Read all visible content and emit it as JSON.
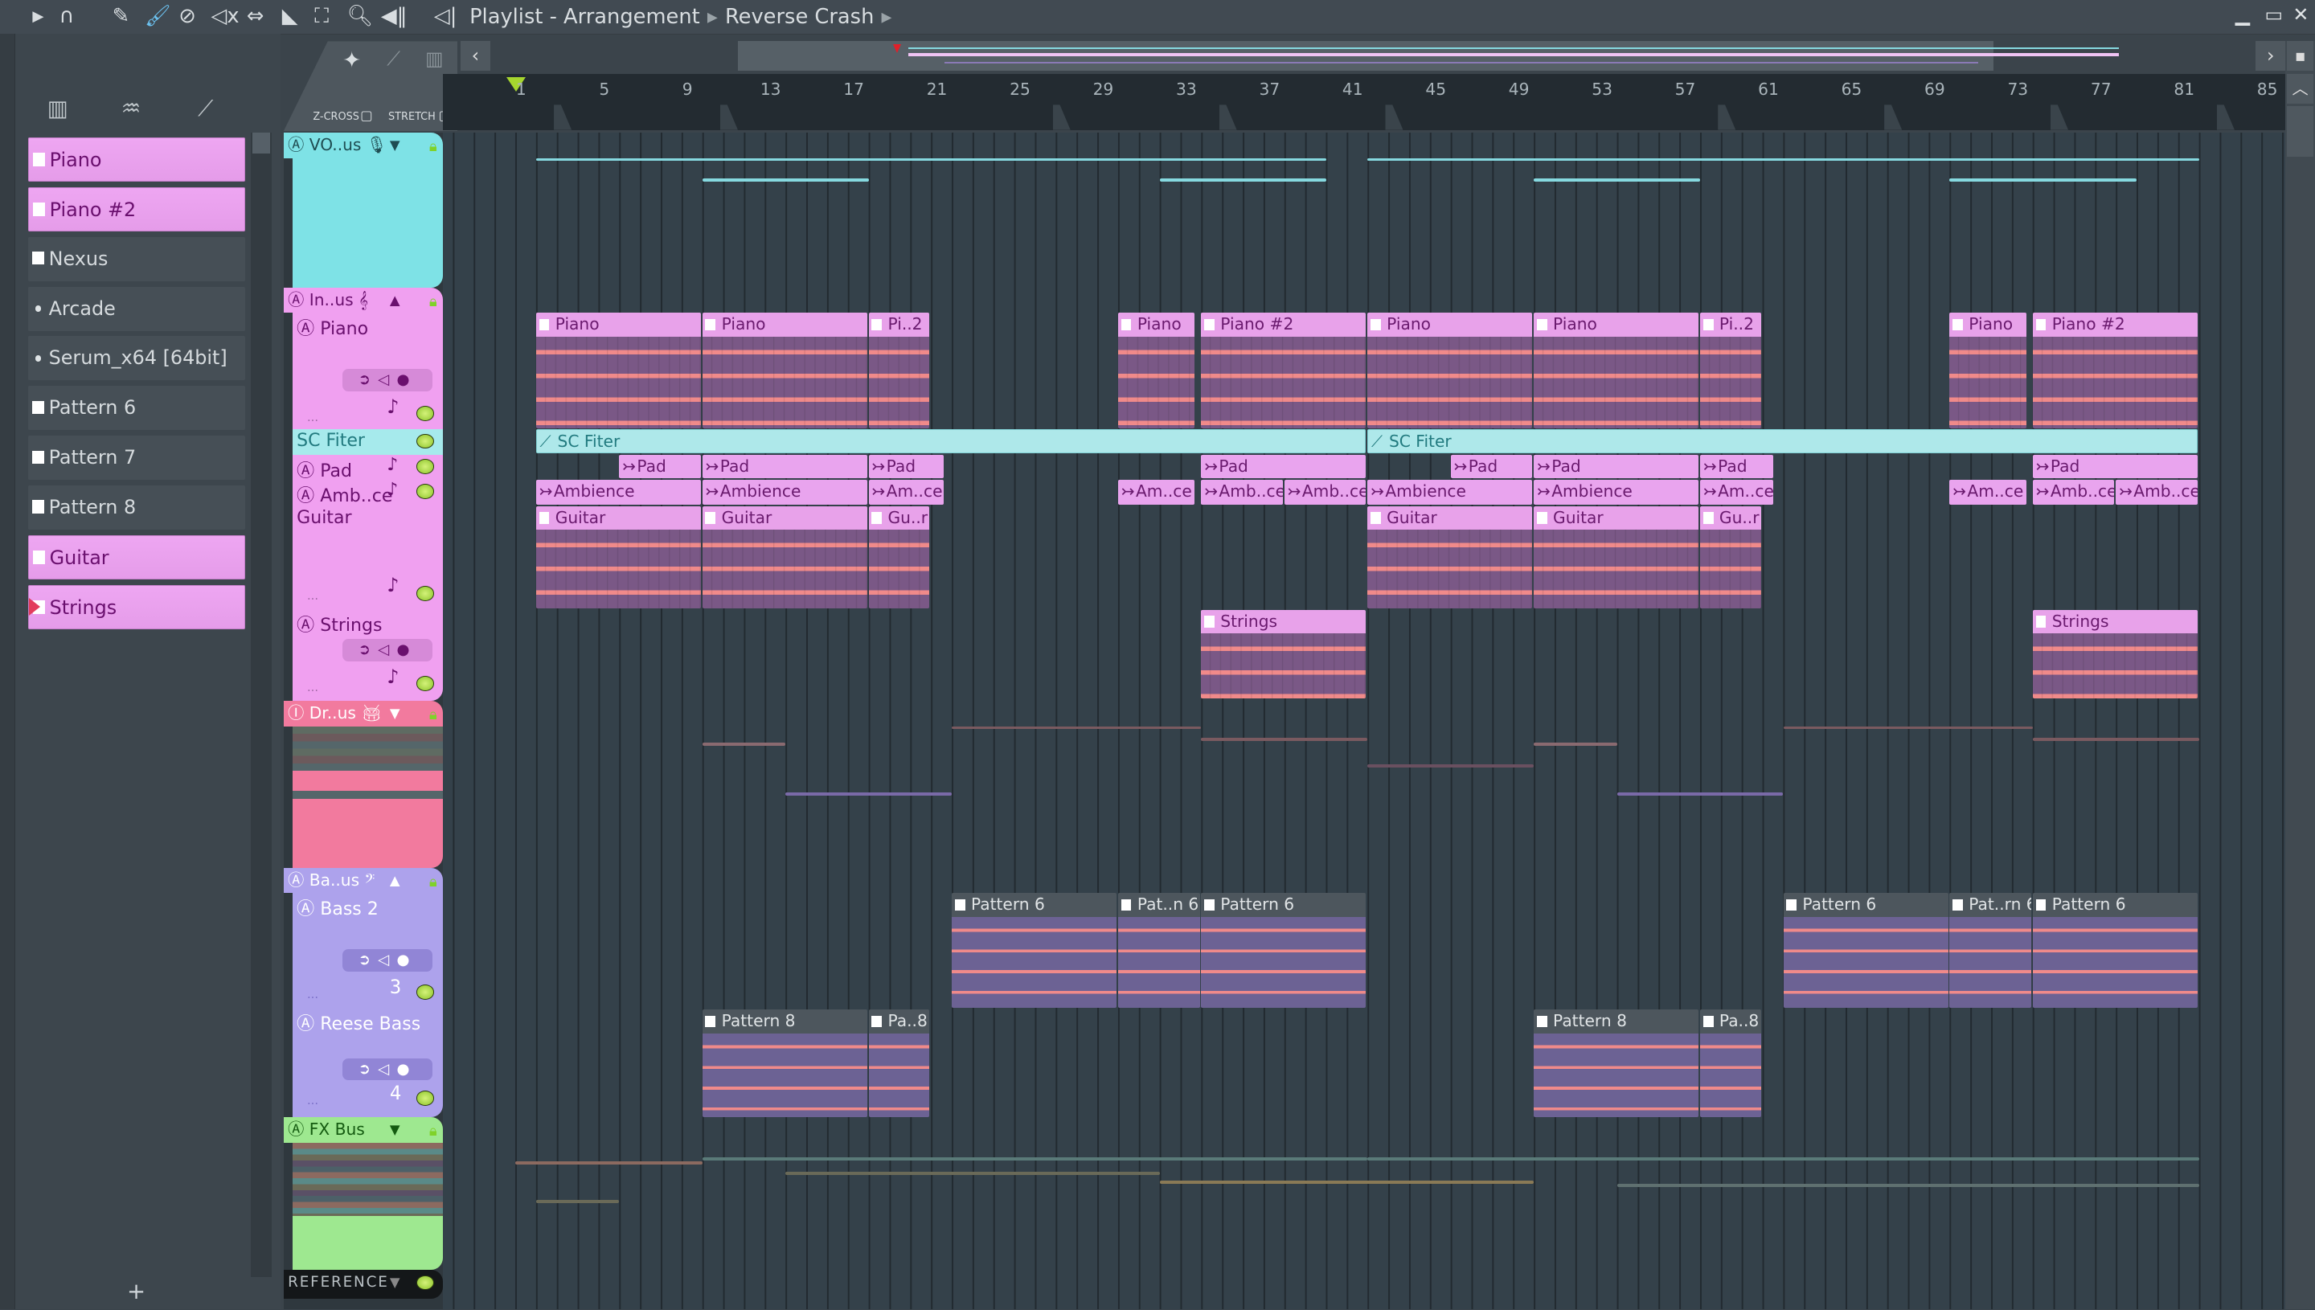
{
  "window": {
    "title": "Playlist - Arrangement",
    "pattern": "Reverse Crash",
    "min_icon": "minimize-icon",
    "max_icon": "maximize-icon",
    "close_icon": "close-icon"
  },
  "toolbar": {
    "icons": [
      "play-arrow-icon",
      "magnet-icon",
      "pencil-icon",
      "paint-brush-icon",
      "delete-icon",
      "mute-icon",
      "slip-icon",
      "slice-icon",
      "select-icon",
      "zoom-icon",
      "playback-icon",
      "speaker-icon"
    ]
  },
  "browser": {
    "items": [
      {
        "label": "Piano",
        "kind": "pattern",
        "style": "pink"
      },
      {
        "label": "Piano #2",
        "kind": "pattern",
        "style": "pink"
      },
      {
        "label": "Nexus",
        "kind": "pattern",
        "style": "gray"
      },
      {
        "label": "Arcade",
        "kind": "plugin",
        "style": "gray"
      },
      {
        "label": "Serum_x64 [64bit]",
        "kind": "plugin",
        "style": "gray"
      },
      {
        "label": "Pattern 6",
        "kind": "pattern",
        "style": "gray"
      },
      {
        "label": "Pattern 7",
        "kind": "pattern",
        "style": "gray"
      },
      {
        "label": "Pattern 8",
        "kind": "pattern",
        "style": "gray"
      },
      {
        "label": "Guitar",
        "kind": "pattern",
        "style": "pink"
      },
      {
        "label": "Strings",
        "kind": "pattern",
        "style": "pink",
        "selected": true
      }
    ],
    "add_label": "+"
  },
  "snap": {
    "zcross": "Z-CROSS",
    "stretch": "STRETCH"
  },
  "ruler": {
    "bars": [
      "1",
      "5",
      "9",
      "13",
      "17",
      "21",
      "25",
      "29",
      "33",
      "37",
      "41",
      "45",
      "49",
      "53",
      "57",
      "61",
      "65",
      "69",
      "73",
      "77",
      "81",
      "85"
    ],
    "playhead_bar": 1
  },
  "tracks": {
    "vo": {
      "label": "VO..us",
      "color": "#7ee2e6"
    },
    "inst": {
      "label": "In..us",
      "color": "#f0a0f0",
      "piano": "Piano",
      "sc": "SC Fiter",
      "pad": "Pad",
      "amb": "Amb..ce",
      "guitar": "Guitar",
      "strings": "Strings"
    },
    "drums": {
      "label": "Dr..us",
      "color": "#f27a9e"
    },
    "bass": {
      "label": "Ba..us",
      "color": "#ada2ec",
      "bass2": "Bass 2",
      "bass2_num": "3",
      "reese": "Reese Bass",
      "reese_num": "4"
    },
    "fx": {
      "label": "FX Bus",
      "color": "#9ee890"
    },
    "reference": {
      "label": "REFERENCE"
    }
  },
  "dots": "...",
  "clips": {
    "piano": [
      {
        "label": "Piano",
        "start": 2,
        "len": 8
      },
      {
        "label": "Piano",
        "start": 10,
        "len": 8
      },
      {
        "label": "Pi..2",
        "start": 18,
        "len": 3
      },
      {
        "label": "Piano",
        "start": 30,
        "len": 3.75
      },
      {
        "label": "Piano #2",
        "start": 34,
        "len": 8
      },
      {
        "label": "Piano",
        "start": 42,
        "len": 8
      },
      {
        "label": "Piano",
        "start": 50,
        "len": 8
      },
      {
        "label": "Pi..2",
        "start": 58,
        "len": 3
      },
      {
        "label": "Piano",
        "start": 70,
        "len": 3.75
      },
      {
        "label": "Piano #2",
        "start": 74,
        "len": 8
      }
    ],
    "sc": [
      {
        "label": "SC Fiter",
        "start": 2,
        "len": 40
      },
      {
        "label": "SC Fiter",
        "start": 42,
        "len": 40
      }
    ],
    "pad": [
      {
        "label": "Pad",
        "start": 6,
        "len": 4
      },
      {
        "label": "Pad",
        "start": 10,
        "len": 8
      },
      {
        "label": "Pad",
        "start": 18,
        "len": 3.7
      },
      {
        "label": "Pad",
        "start": 34,
        "len": 8
      },
      {
        "label": "Pad",
        "start": 46,
        "len": 4
      },
      {
        "label": "Pad",
        "start": 50,
        "len": 8
      },
      {
        "label": "Pad",
        "start": 58,
        "len": 3.6
      },
      {
        "label": "Pad",
        "start": 74,
        "len": 8
      }
    ],
    "amb": [
      {
        "label": "Ambience",
        "start": 2,
        "len": 8
      },
      {
        "label": "Ambience",
        "start": 10,
        "len": 8
      },
      {
        "label": "Am..ce",
        "start": 18,
        "len": 3.7
      },
      {
        "label": "Am..ce",
        "start": 30,
        "len": 3.75
      },
      {
        "label": "Amb..ce",
        "start": 34,
        "len": 4
      },
      {
        "label": "Amb..ce",
        "start": 38,
        "len": 4
      },
      {
        "label": "Ambience",
        "start": 42,
        "len": 8
      },
      {
        "label": "Ambience",
        "start": 50,
        "len": 8
      },
      {
        "label": "Am..ce",
        "start": 58,
        "len": 3.6
      },
      {
        "label": "Am..ce",
        "start": 70,
        "len": 3.75
      },
      {
        "label": "Amb..ce",
        "start": 74,
        "len": 4
      },
      {
        "label": "Amb..ce",
        "start": 78,
        "len": 4
      }
    ],
    "guitar": [
      {
        "label": "Guitar",
        "start": 2,
        "len": 8
      },
      {
        "label": "Guitar",
        "start": 10,
        "len": 8
      },
      {
        "label": "Gu..r",
        "start": 18,
        "len": 3
      },
      {
        "label": "Guitar",
        "start": 42,
        "len": 8
      },
      {
        "label": "Guitar",
        "start": 50,
        "len": 8
      },
      {
        "label": "Gu..r",
        "start": 58,
        "len": 3
      }
    ],
    "strings": [
      {
        "label": "Strings",
        "start": 34,
        "len": 8
      },
      {
        "label": "Strings",
        "start": 74,
        "len": 8
      }
    ],
    "bass2": [
      {
        "label": "Pattern 6",
        "start": 22,
        "len": 8
      },
      {
        "label": "Pat..n 6",
        "start": 30,
        "len": 4
      },
      {
        "label": "Pattern 6",
        "start": 34,
        "len": 8
      },
      {
        "label": "Pattern 6",
        "start": 62,
        "len": 8
      },
      {
        "label": "Pat..rn 6",
        "start": 70,
        "len": 4
      },
      {
        "label": "Pattern 6",
        "start": 74,
        "len": 8
      }
    ],
    "reese": [
      {
        "label": "Pattern 8",
        "start": 10,
        "len": 8
      },
      {
        "label": "Pa..8",
        "start": 18,
        "len": 3
      },
      {
        "label": "Pattern 8",
        "start": 50,
        "len": 8
      },
      {
        "label": "Pa..8",
        "start": 58,
        "len": 3
      }
    ]
  }
}
